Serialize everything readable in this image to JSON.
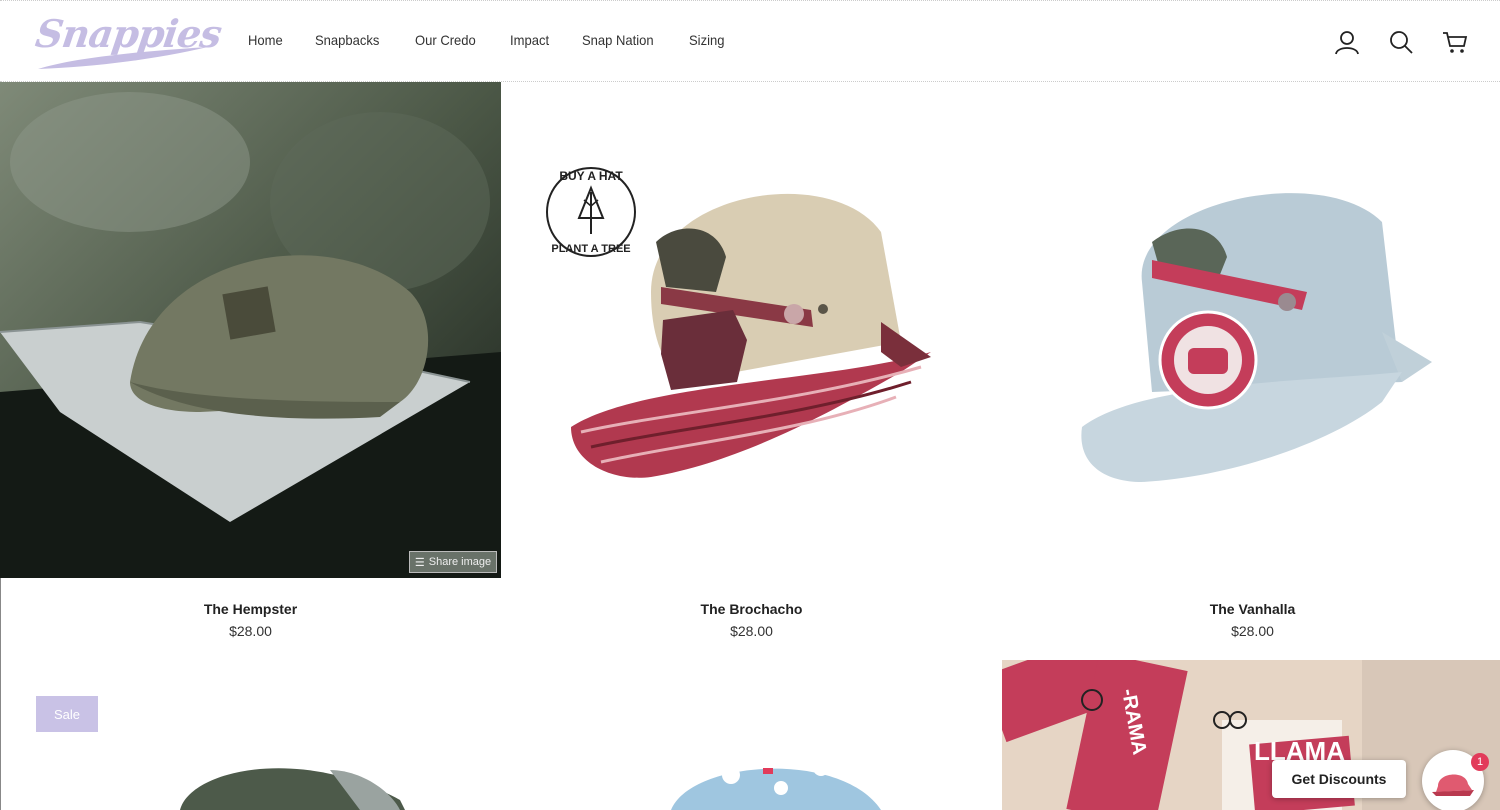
{
  "brand": {
    "logo_text": "Snappies",
    "logo_color": "#c5bde3"
  },
  "nav": {
    "items": [
      {
        "label": "Home"
      },
      {
        "label": "Snapbacks"
      },
      {
        "label": "Our Credo"
      },
      {
        "label": "Impact"
      },
      {
        "label": "Snap Nation"
      },
      {
        "label": "Sizing"
      }
    ]
  },
  "header_icons": [
    "user-icon",
    "search-icon",
    "cart-icon"
  ],
  "products": [
    {
      "title": "The Hempster",
      "price": "$28.00"
    },
    {
      "title": "The Brochacho",
      "price": "$28.00"
    },
    {
      "title": "The Vanhalla",
      "price": "$28.00"
    }
  ],
  "share": {
    "label": "Share image"
  },
  "promo_badge": {
    "top": "BUY A HAT",
    "bottom": "PLANT A TREE"
  },
  "sale": {
    "label": "Sale"
  },
  "discounts": {
    "label": "Get Discounts",
    "count": "1"
  },
  "sticker_text": {
    "word": "LLAMA",
    "rama": "-RAMA"
  },
  "colors": {
    "accent": "#c9c2e6",
    "badge_red": "#e23b5a"
  }
}
